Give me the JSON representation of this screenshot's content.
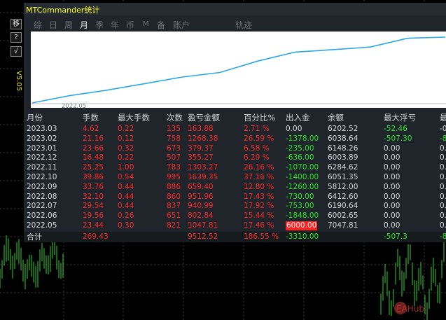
{
  "panel": {
    "title": "MTCommander统计",
    "version": "V5.05"
  },
  "toolbar": {
    "zoom_label": "移",
    "help_label": "?",
    "check_label": "√"
  },
  "tabs": [
    {
      "label": "综",
      "active": false
    },
    {
      "label": "日",
      "active": false
    },
    {
      "label": "周",
      "active": false
    },
    {
      "label": "月",
      "active": true
    },
    {
      "label": "季",
      "active": false
    },
    {
      "label": "年",
      "active": false
    },
    {
      "label": "币",
      "active": false
    },
    {
      "label": "M",
      "active": false
    },
    {
      "label": "备",
      "active": false
    },
    {
      "label": "账户",
      "active": false
    },
    {
      "label": "轨迹",
      "active": false
    }
  ],
  "chart": {
    "start_label": "2022.05",
    "line_color": "#2aa8e8",
    "equity": [
      0.0,
      1047.81,
      1850.65,
      2791.64,
      3743.6,
      4403.0,
      6042.35,
      7345.62,
      7700.89,
      8080.26,
      9348.64,
      9512.52
    ]
  },
  "table": {
    "columns": [
      "月份",
      "手数",
      "最大手数",
      "次数",
      "盈亏金额",
      "百分比%",
      "出入金",
      "余额",
      "最大浮亏",
      "最"
    ],
    "rows": [
      {
        "month": "2023.03",
        "lots": "4.62",
        "max_lots": "0.22",
        "count": "135",
        "pnl": "163.88",
        "pct": "2.71 %",
        "flow": "0.00",
        "balance": "6202.52",
        "max_dd": "-52.46",
        "last": "-0"
      },
      {
        "month": "2023.02",
        "lots": "21.16",
        "max_lots": "0.12",
        "count": "758",
        "pnl": "1268.38",
        "pct": "26.59 %",
        "flow": "-1378.00",
        "balance": "6038.64",
        "max_dd": "-507.30",
        "last": "-8"
      },
      {
        "month": "2023.01",
        "lots": "23.66",
        "max_lots": "0.32",
        "count": "673",
        "pnl": "379.37",
        "pct": "6.58 %",
        "flow": "-235.00",
        "balance": "6148.26",
        "max_dd": "0.00",
        "last": "0."
      },
      {
        "month": "2022.12",
        "lots": "16.48",
        "max_lots": "0.22",
        "count": "507",
        "pnl": "355.27",
        "pct": "6.29 %",
        "flow": "-636.00",
        "balance": "6003.89",
        "max_dd": "0.00",
        "last": "0."
      },
      {
        "month": "2022.11",
        "lots": "25.25",
        "max_lots": "1.00",
        "count": "783",
        "pnl": "1303.27",
        "pct": "26.16 %",
        "flow": "-1070.00",
        "balance": "6284.62",
        "max_dd": "0.00",
        "last": "0."
      },
      {
        "month": "2022.10",
        "lots": "39.86",
        "max_lots": "0.54",
        "count": "995",
        "pnl": "1639.35",
        "pct": "37.16 %",
        "flow": "-1400.00",
        "balance": "6051.35",
        "max_dd": "0.00",
        "last": "0."
      },
      {
        "month": "2022.09",
        "lots": "33.76",
        "max_lots": "0.44",
        "count": "886",
        "pnl": "659.40",
        "pct": "12.80 %",
        "flow": "-1260.00",
        "balance": "5812.00",
        "max_dd": "0.00",
        "last": "0."
      },
      {
        "month": "2022.08",
        "lots": "32.10",
        "max_lots": "0.44",
        "count": "860",
        "pnl": "951.96",
        "pct": "17.43 %",
        "flow": "-730.00",
        "balance": "6412.60",
        "max_dd": "0.00",
        "last": "0."
      },
      {
        "month": "2022.07",
        "lots": "29.54",
        "max_lots": "0.44",
        "count": "837",
        "pnl": "940.99",
        "pct": "17.92 %",
        "flow": "-753.00",
        "balance": "6190.64",
        "max_dd": "0.00",
        "last": "0."
      },
      {
        "month": "2022.06",
        "lots": "19.56",
        "max_lots": "0.26",
        "count": "651",
        "pnl": "802.84",
        "pct": "15.44 %",
        "flow": "-1848.00",
        "balance": "6002.65",
        "max_dd": "0.00",
        "last": "0."
      },
      {
        "month": "2022.05",
        "lots": "23.44",
        "max_lots": "0.30",
        "count": "821",
        "pnl": "1047.81",
        "pct": "17.46 %",
        "flow": "6000.00",
        "balance": "7047.81",
        "max_dd": "0.00",
        "last": "0."
      }
    ],
    "total": {
      "label": "合计",
      "lots": "269.43",
      "pnl": "9512.52",
      "pct": "186.55 %",
      "flow": "-3310.00",
      "max_dd": "-507.3",
      "last": "-8"
    }
  },
  "watermark": {
    "text": "EAHub"
  },
  "colors": {
    "profit": "#ff2424",
    "loss": "#25e625",
    "panel_bg": "#1f252a",
    "title": "#ffff33",
    "candles": "#2fd12f"
  }
}
